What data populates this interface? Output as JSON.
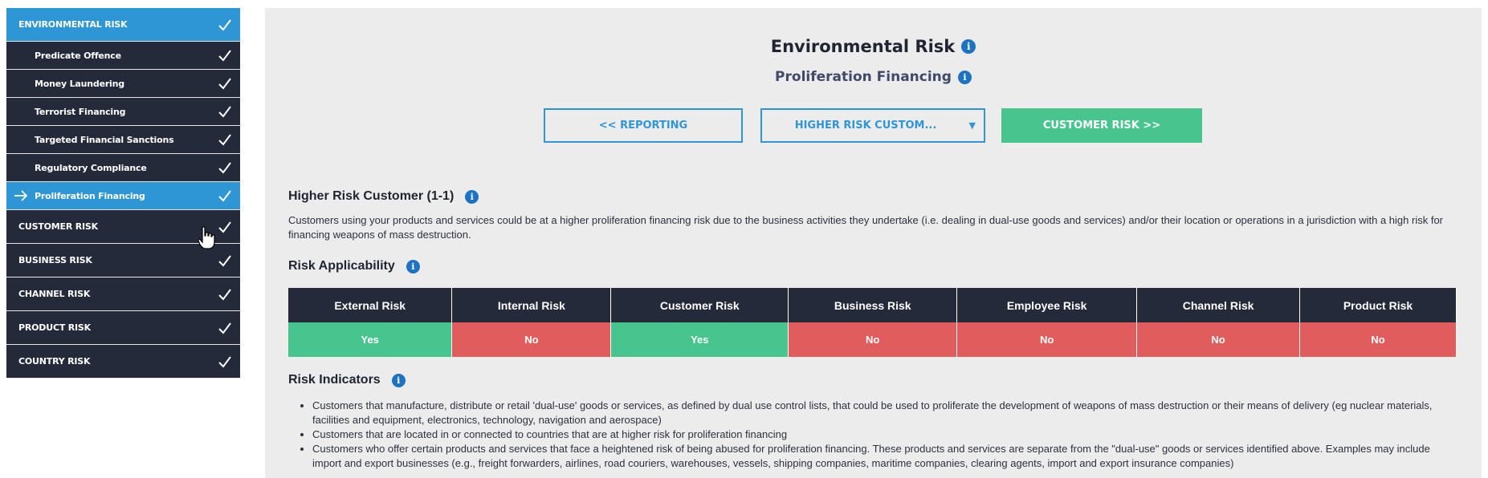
{
  "sidebar": {
    "items": [
      {
        "label": "ENVIRONMENTAL RISK",
        "kind": "top",
        "active": true
      },
      {
        "label": "Predicate Offence",
        "kind": "sub"
      },
      {
        "label": "Money Laundering",
        "kind": "sub"
      },
      {
        "label": "Terrorist Financing",
        "kind": "sub"
      },
      {
        "label": "Targeted Financial Sanctions",
        "kind": "sub"
      },
      {
        "label": "Regulatory Compliance",
        "kind": "sub"
      },
      {
        "label": "Proliferation Financing",
        "kind": "sub",
        "active": true,
        "current": true
      },
      {
        "label": "CUSTOMER RISK",
        "kind": "top"
      },
      {
        "label": "BUSINESS RISK",
        "kind": "top"
      },
      {
        "label": "CHANNEL RISK",
        "kind": "top"
      },
      {
        "label": "PRODUCT RISK",
        "kind": "top"
      },
      {
        "label": "COUNTRY RISK",
        "kind": "top"
      }
    ]
  },
  "header": {
    "title": "Environmental Risk",
    "subtitle": "Proliferation Financing"
  },
  "nav": {
    "prev_label": "<< REPORTING",
    "select_value": "HIGHER RISK CUSTOM...",
    "next_label": "CUSTOMER RISK >>"
  },
  "section": {
    "title": "Higher Risk Customer (1-1)",
    "description": "Customers using your products and services could be at a higher proliferation financing risk due to the business activities they undertake (i.e. dealing in dual-use goods and services) and/or their location or operations in a jurisdiction with a high risk for financing weapons of mass destruction."
  },
  "applicability": {
    "title": "Risk Applicability",
    "columns": [
      "External Risk",
      "Internal Risk",
      "Customer Risk",
      "Business Risk",
      "Employee Risk",
      "Channel Risk",
      "Product Risk"
    ],
    "values": [
      "Yes",
      "No",
      "Yes",
      "No",
      "No",
      "No",
      "No"
    ]
  },
  "indicators": {
    "title": "Risk Indicators",
    "items": [
      "Customers that manufacture, distribute or retail 'dual-use' goods or services, as defined by dual use control lists, that could be used to proliferate the development of weapons of mass destruction or their means of delivery (eg nuclear materials, facilities and equipment, electronics, technology, navigation and aerospace)",
      "Customers that are located in or connected to countries that are at higher risk for proliferation financing",
      "Customers who offer certain products and services that face a heightened risk of being abused for proliferation financing. These products and services are separate from the \"dual-use\" goods or services identified above. Examples may include import and export businesses (e.g., freight forwarders, airlines, road couriers, warehouses, vessels, shipping companies, maritime companies, clearing agents, import and export insurance companies)"
    ]
  },
  "colors": {
    "sidebar_dark": "#252a3a",
    "accent_blue": "#2f96d6",
    "yes_green": "#48c48f",
    "no_red": "#e05c5d",
    "info_blue": "#1d72c2"
  }
}
